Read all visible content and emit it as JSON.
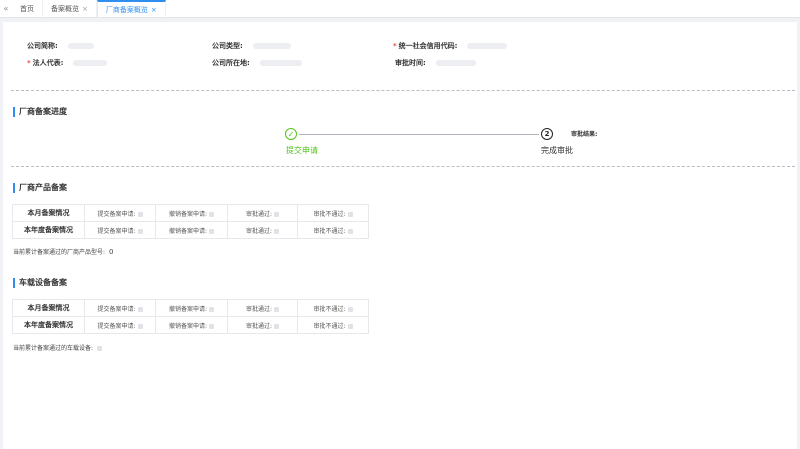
{
  "tabs": {
    "back_icon": "«",
    "items": [
      {
        "label": "首页",
        "closable": false
      },
      {
        "label": "备案概览",
        "closable": true
      },
      {
        "label": "厂商备案概览",
        "closable": true,
        "active": true
      }
    ],
    "close_glyph": "×"
  },
  "company_info": {
    "short_name_label": "公司简称:",
    "type_label": "公司类型:",
    "credit_code_label": "统一社会信用代码:",
    "legal_rep_label": "法人代表:",
    "location_label": "公司所在地:",
    "approval_time_label": "审批时间:"
  },
  "progress": {
    "title": "厂商备案进度",
    "step1_label": "提交申请",
    "step1_icon": "✓",
    "step2_number": "2",
    "step2_label": "完成审批",
    "result_label": "审批结果:"
  },
  "vendor_products": {
    "title": "厂商产品备案",
    "rows": [
      {
        "label": "本月备案情况",
        "submit": "提交备案申请:",
        "revoke": "撤销备案申请:",
        "passed": "审批通过:",
        "failed": "审批不通过:"
      },
      {
        "label": "本年度备案情况",
        "submit": "提交备案申请:",
        "revoke": "撤销备案申请:",
        "passed": "审批通过:",
        "failed": "审批不通过:"
      }
    ],
    "note_label": "当前累计备案通过的厂商产品型号:",
    "note_value": "0"
  },
  "vehicle_devices": {
    "title": "车载设备备案",
    "rows": [
      {
        "label": "本月备案情况",
        "submit": "提交备案申请:",
        "revoke": "撤销备案申请:",
        "passed": "审批通过:",
        "failed": "审批不通过:"
      },
      {
        "label": "本年度备案情况",
        "submit": "提交备案申请:",
        "revoke": "撤销备案申请:",
        "passed": "审批通过:",
        "failed": "审批不通过:"
      }
    ],
    "note_label": "当前累计备案通过的车载设备:"
  },
  "colors": {
    "accent": "#2f8ef0",
    "success": "#52c41a",
    "required": "#e54d42"
  }
}
